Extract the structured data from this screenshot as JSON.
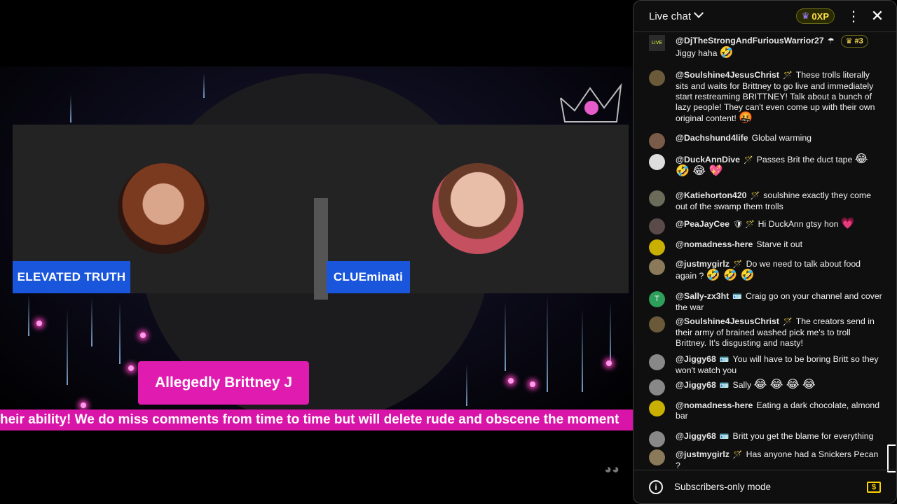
{
  "video": {
    "guest_left_name": "ELEVATED TRUTH",
    "guest_right_name": "CLUEminati",
    "host_name": "Allegedly Brittney J",
    "ticker_text": "heir ability! We do miss comments from time to time but will delete rude and obscene the moment",
    "watermark_icon": "mask-icon"
  },
  "chat": {
    "title": "Live chat",
    "xp_label": "0XP",
    "footer_text": "Subscribers-only mode",
    "messages": [
      {
        "author": "@DjTheStrongAndFuriousWarrior27",
        "badge": "☂",
        "rank": "#3",
        "text": "Jiggy haha",
        "emoji": "🤣",
        "avatar_color": "#2b2b2b",
        "avatar_text": "LIVE"
      },
      {
        "author": "@Soulshine4JesusChrist",
        "badge": "🪄",
        "text": "These trolls literally sits and waits for Brittney to go live and immediately start restreaming BRITTNEY! Talk about a bunch of lazy people! They can't even come up with their own original content!",
        "emoji": "🤬",
        "avatar_color": "#6a5a3a",
        "avatar_text": ""
      },
      {
        "author": "@Dachshund4life",
        "badge": "",
        "text": "Global warming",
        "emoji": "",
        "avatar_color": "#7a5b4a",
        "avatar_text": ""
      },
      {
        "author": "@DuckAnnDive",
        "badge": "🪄",
        "text": "Passes Brit the duct tape",
        "emoji": "😂 🤣 😂 💖",
        "avatar_color": "#ddd",
        "avatar_text": ""
      },
      {
        "author": "@Katiehorton420",
        "badge": "🪄",
        "text": "soulshine exactly they come out of the swamp them trolls",
        "emoji": "",
        "avatar_color": "#6b6b5a",
        "avatar_text": ""
      },
      {
        "author": "@PeaJayCee",
        "badge": "🛡 🪄",
        "text": "Hi DuckAnn gtsy hon",
        "emoji": "💗",
        "avatar_color": "#5a4a4a",
        "avatar_text": ""
      },
      {
        "author": "@nomadness-here",
        "badge": "",
        "text": "Starve it out",
        "emoji": "",
        "avatar_color": "#c9b000",
        "avatar_text": ""
      },
      {
        "author": "@justmygirlz",
        "badge": "🪄",
        "text": "Do we need to talk about food again ?",
        "emoji": "🤣 🤣 🤣",
        "avatar_color": "#8a7a5a",
        "avatar_text": ""
      },
      {
        "author": "@Sally-zx3ht",
        "badge": "🪪",
        "text": "Craig go on your channel and cover the war",
        "emoji": "",
        "avatar_color": "#2e9e5b",
        "avatar_text": "T"
      },
      {
        "author": "@Soulshine4JesusChrist",
        "badge": "🪄",
        "text": "The creators send in their army of brained washed pick me's to troll Brittney. It's disgusting and nasty!",
        "emoji": "",
        "avatar_color": "#6a5a3a",
        "avatar_text": ""
      },
      {
        "author": "@Jiggy68",
        "badge": "🪪",
        "text": "You will have to be boring Britt so they won't watch you",
        "emoji": "",
        "avatar_color": "#888",
        "avatar_text": ""
      },
      {
        "author": "@Jiggy68",
        "badge": "🪪",
        "text": "Sally",
        "emoji": "😂 😂 😂 😂",
        "avatar_color": "#888",
        "avatar_text": ""
      },
      {
        "author": "@nomadness-here",
        "badge": "",
        "text": "Eating a dark chocolate, almond bar",
        "emoji": "",
        "avatar_color": "#c9b000",
        "avatar_text": ""
      },
      {
        "author": "@Jiggy68",
        "badge": "🪪",
        "text": "Britt you get the blame for everything",
        "emoji": "",
        "avatar_color": "#888",
        "avatar_text": ""
      },
      {
        "author": "@justmygirlz",
        "badge": "🪄",
        "text": "Has anyone had a Snickers Pecan ?",
        "emoji": "",
        "avatar_color": "#8a7a5a",
        "avatar_text": ""
      }
    ]
  }
}
